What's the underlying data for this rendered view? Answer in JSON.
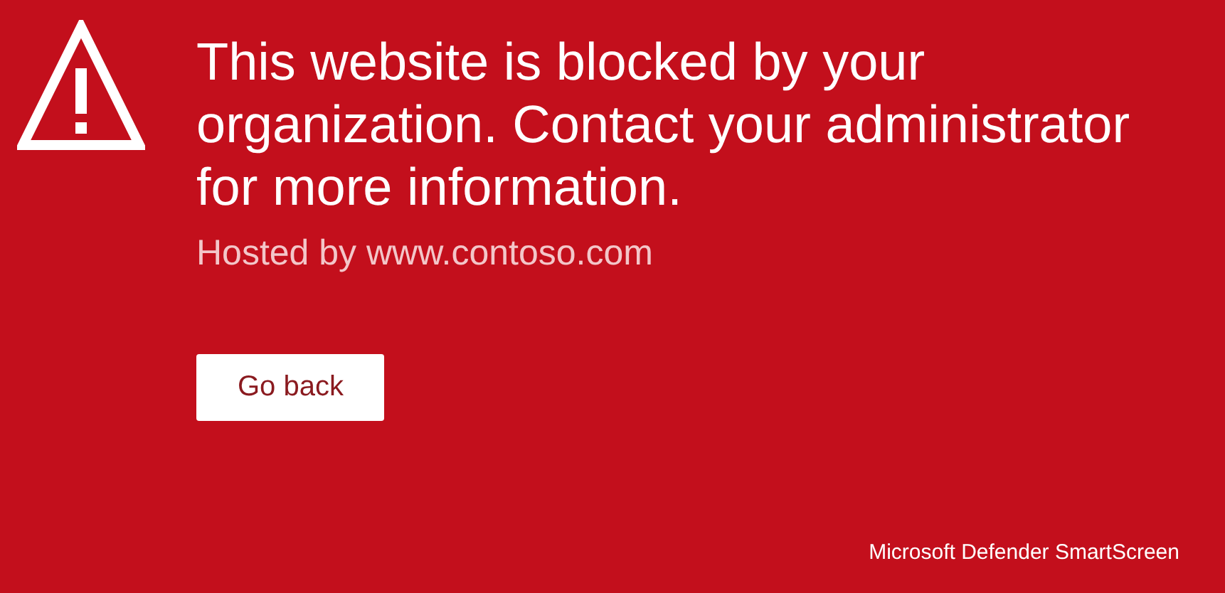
{
  "message": "This website is blocked by your organization. Contact your administrator for more information.",
  "hosted_by": "Hosted by www.contoso.com",
  "buttons": [
    "Go back"
  ],
  "footer": "Microsoft Defender SmartScreen"
}
